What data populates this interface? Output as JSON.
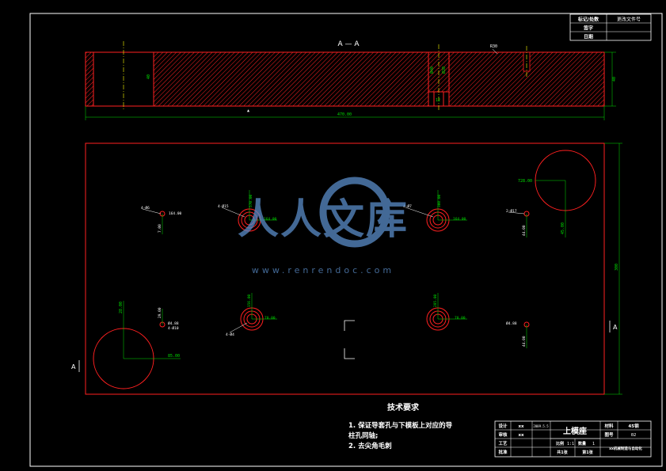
{
  "section_title": "A — A",
  "section_marker": "A",
  "dimensions": {
    "total_width": "470.00",
    "height": "300"
  },
  "top_labels": {
    "label_1": "R30",
    "label_2": "Ø20",
    "label_3": "Ø40",
    "label_4": "12",
    "label_5": "40"
  },
  "revision_table": {
    "rows": [
      {
        "key": "标记/处数",
        "value": "更改文件号"
      },
      {
        "key": "签字",
        "value": ""
      },
      {
        "key": "日期",
        "value": ""
      }
    ]
  },
  "tech_requirements": {
    "heading": "技术要求",
    "line1": "1. 保证导套孔与下模板上对应的导",
    "line2": "柱孔同轴;",
    "line3": "2. 去尖角毛刺"
  },
  "plan_labels": {
    "h1_left": "4-Ø6",
    "h1_right": "164.00",
    "h1_down": "7.00",
    "h2_left": "4-Ø15",
    "h2_up": "570.00",
    "h2_right": "164.00",
    "h3_left": "4-Ø7",
    "h3_up": "300.00",
    "h3_right": "164.00",
    "h4_left": "2-Ø17",
    "h4_down": "44.00",
    "big_tr_left": "728.00",
    "big_tr_down": "45.00",
    "big_bl_up": "28.00",
    "big_bl_right": "85.00",
    "h5_left": "Ø4.88",
    "h5_up": "29.00",
    "h5_sub": "4-Ø10",
    "h6_up": "156.00",
    "h6_left": "4-Ø4",
    "h6_right": "70.00",
    "h7_up": "285.00",
    "h7_right": "70.00",
    "h8_left": "Ø4.88",
    "h8_down": "44.00"
  },
  "title_block": {
    "designer_label": "设计",
    "checker_label": "审核",
    "craft_label": "工艺",
    "approver_label": "批准",
    "designer_name": "xx",
    "checker_name": "xx",
    "date": "2009.5.5",
    "part_name": "上模座",
    "material_label": "材料",
    "material_value": "45钢",
    "ratio_label": "比例",
    "ratio_value": "1:1",
    "sheet_label": "共1张",
    "sheet_no": "第1张",
    "quantity_label": "数量",
    "quantity_value": "1",
    "number_label": "图号",
    "number_value": "02",
    "school": "xx机械制造与自动化"
  },
  "watermark": {
    "text_cn": "人人文库",
    "url": "www.renrendoc.com"
  },
  "colors": {
    "frame": "#ffffff",
    "outline": "#ff2020",
    "dimension": "#00e000",
    "centerline": "#ffff00",
    "watermark": "#5a8cc8"
  }
}
